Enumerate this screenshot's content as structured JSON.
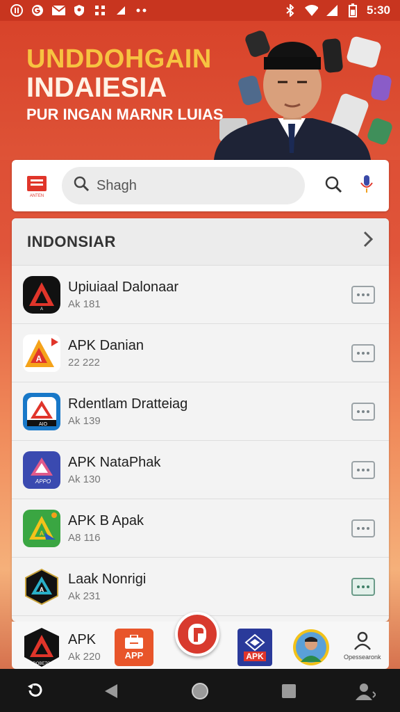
{
  "status_bar": {
    "time": "5:30",
    "icons": [
      "app-icon-1",
      "app-icon-2",
      "mail-icon",
      "shield-icon",
      "grid-icon",
      "signal-icon",
      "dots-icon"
    ],
    "right_icons": [
      "bluetooth-icon",
      "wifi-icon",
      "signal-icon",
      "battery-icon"
    ]
  },
  "hero": {
    "title_line1": "UNDDOHGAIN",
    "title_line2": "INDAIESIA",
    "subtitle": "PUR INGAN MARNR LUIAS"
  },
  "search": {
    "placeholder": "Shagh",
    "logo_text": "ANTEN"
  },
  "list": {
    "header": "INDONSIAR",
    "items": [
      {
        "name": "Upiuiaal Dalonaar",
        "sub": "Ak 181",
        "icon_label": "A"
      },
      {
        "name": "APK Danian",
        "sub": "22 222",
        "icon_label": "A"
      },
      {
        "name": "Rdentlam Dratteiag",
        "sub": "Ak 139",
        "icon_label": "AIO"
      },
      {
        "name": "APK NataPhak",
        "sub": "Ak 130",
        "icon_label": "APPO"
      },
      {
        "name": "APK B Apak",
        "sub": "A8 116",
        "icon_label": "A"
      },
      {
        "name": "Laak Nonrigi",
        "sub": "Ak 231",
        "icon_label": "A"
      }
    ]
  },
  "dock": {
    "item1_name": "APK",
    "item1_sub": "Ak 220",
    "item1_icon_label": "DOBETO",
    "app_label": "APP",
    "apk_label": "APK",
    "profile_label": "Opessearonk"
  },
  "colors": {
    "brand_red": "#d83a2e",
    "title_yellow": "#f7c341"
  }
}
